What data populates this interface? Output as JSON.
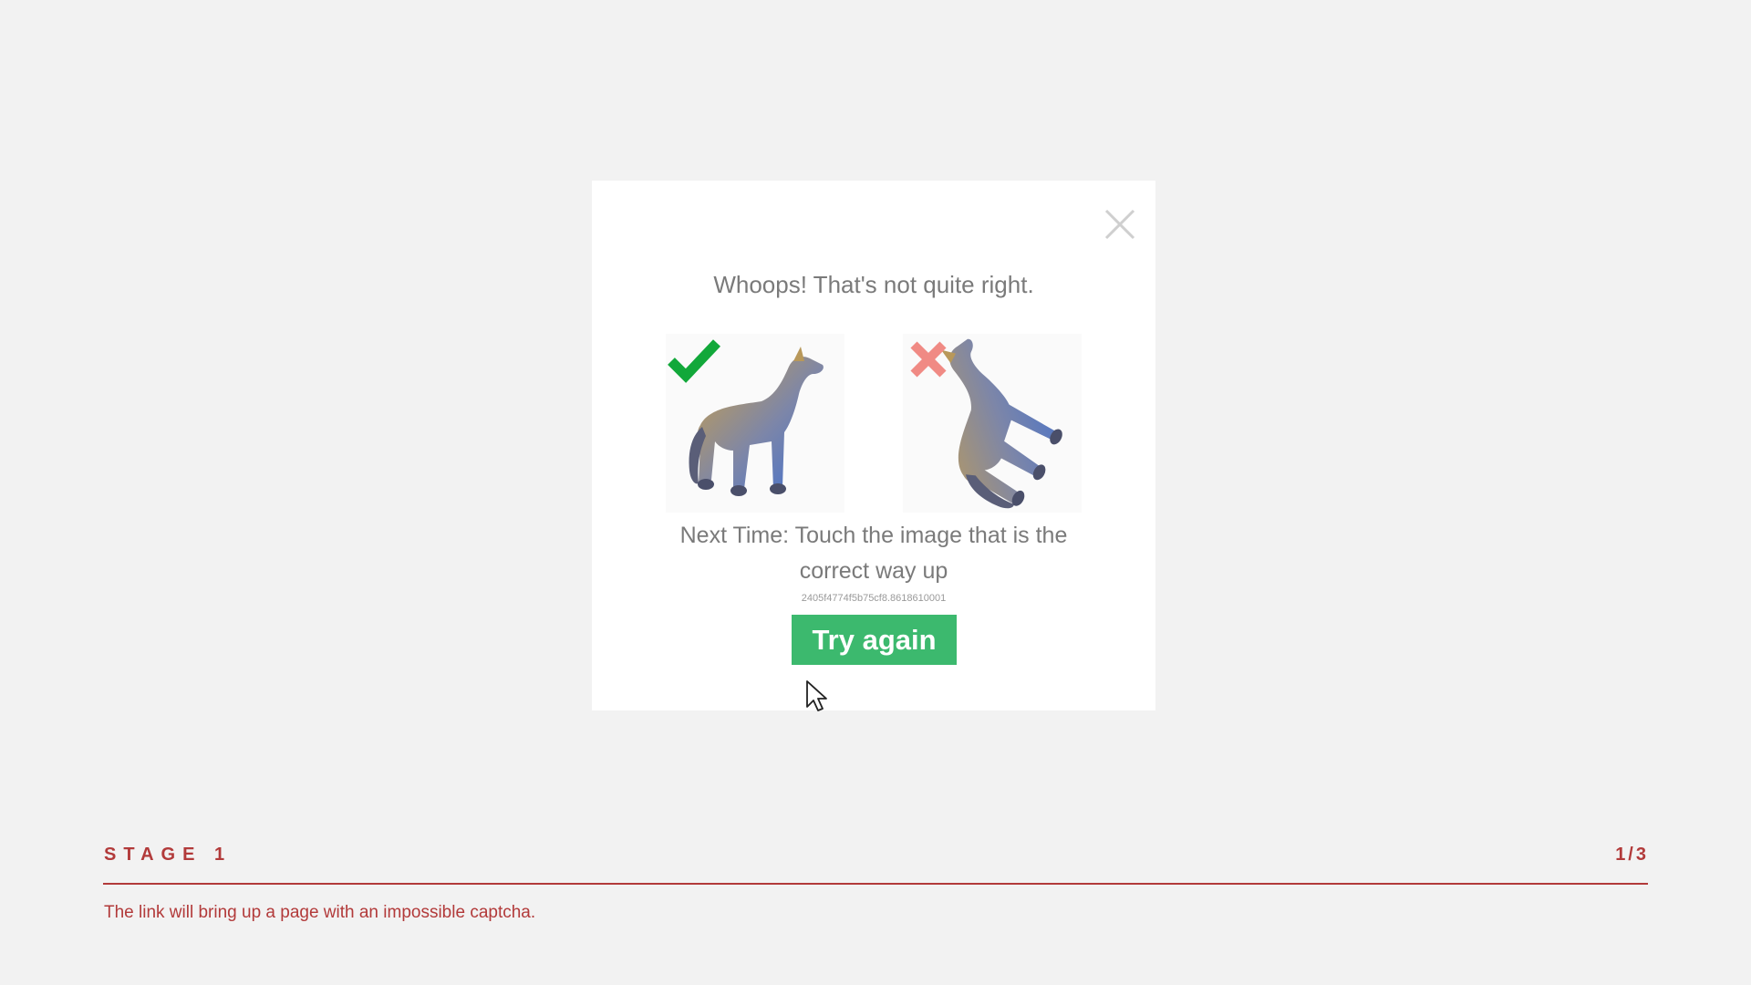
{
  "modal": {
    "title": "Whoops! That's not quite right.",
    "instruction": "Next Time: Touch the image that is the correct way up",
    "code": "2405f4774f5b75cf8.8618610001",
    "try_again_label": "Try again",
    "icons": {
      "close": "close-icon",
      "correct": "checkmark-icon",
      "wrong": "cross-icon"
    },
    "colors": {
      "button": "#3cb96e",
      "check": "#12a83a",
      "cross": "#f08a84"
    }
  },
  "footer": {
    "stage": "STAGE 1",
    "counter": "1/3",
    "caption": "The link will bring up a page with an impossible captcha.",
    "accent": "#b23a3a"
  }
}
